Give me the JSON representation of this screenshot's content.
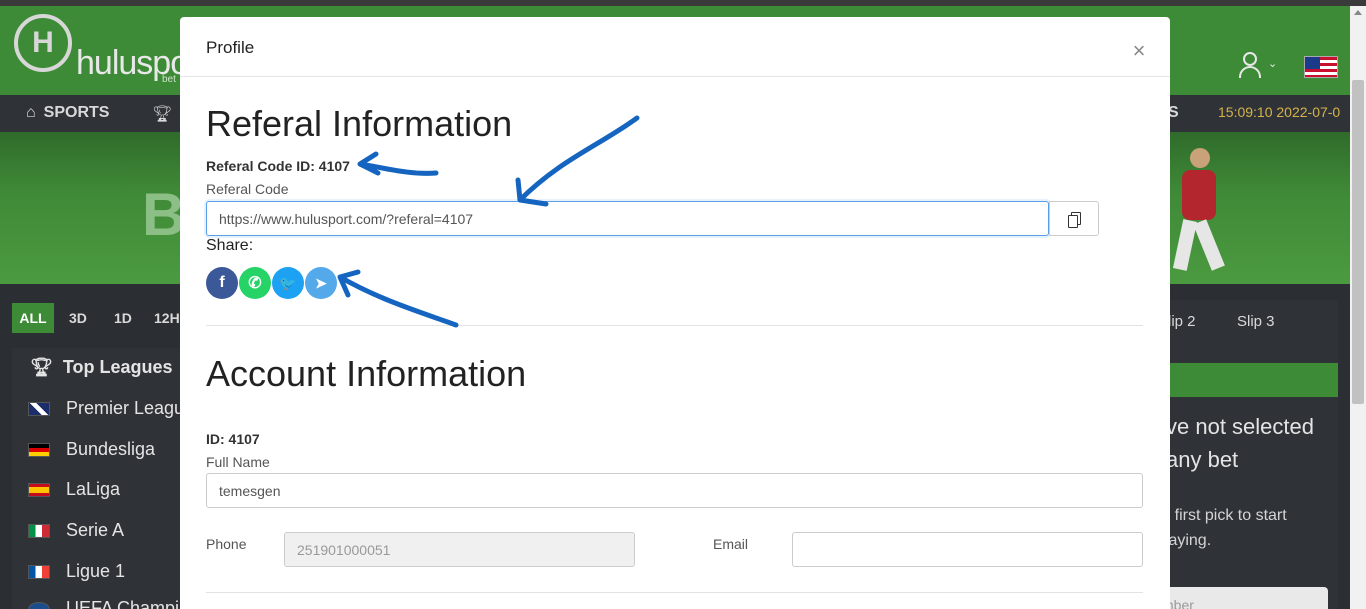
{
  "site": {
    "logo_letter": "H",
    "logo_text": "huluspo",
    "logo_sub": "bet",
    "nav": {
      "sports": "SPORTS",
      "right_fragment": "S",
      "clock": "15:09:10 2022-07-0"
    },
    "banner_letter": "B",
    "filters": [
      "ALL",
      "3D",
      "1D",
      "12H"
    ],
    "top_leagues_title": "Top Leagues",
    "leagues": [
      {
        "name": "Premier Leagu",
        "flag": "england"
      },
      {
        "name": "Bundesliga",
        "flag": "germany"
      },
      {
        "name": "LaLiga",
        "flag": "spain"
      },
      {
        "name": "Serie A",
        "flag": "italy"
      },
      {
        "name": "Ligue 1",
        "flag": "france"
      },
      {
        "name": "UEFA Champi",
        "flag": "europe"
      }
    ],
    "slip_tabs": [
      "lip 2",
      "Slip 3"
    ],
    "slip_message": "ve not selected any bet",
    "slip_sub": "ur first pick to start playing.",
    "slip_input_placeholder": "mber"
  },
  "modal": {
    "title": "Profile",
    "referral": {
      "heading": "Referal Information",
      "code_id": "Referal Code ID: 4107",
      "code_label": "Referal Code",
      "code_value": "https://www.hulusport.com/?referal=4107",
      "share_label": "Share:",
      "share_buttons": [
        {
          "name": "facebook",
          "glyph": "f",
          "color": "#3b5998"
        },
        {
          "name": "whatsapp",
          "glyph": "✆",
          "color": "#25d366"
        },
        {
          "name": "twitter",
          "glyph": "🐦",
          "color": "#1da1f2"
        },
        {
          "name": "telegram",
          "glyph": "➤",
          "color": "#54a9eb"
        }
      ]
    },
    "account": {
      "heading": "Account Information",
      "id": "ID: 4107",
      "full_name_label": "Full Name",
      "full_name_value": "temesgen",
      "phone_label": "Phone",
      "phone_value": "251901000051",
      "email_label": "Email",
      "email_value": ""
    }
  },
  "colors": {
    "brand_green": "#3d8b37",
    "annotation_blue": "#1565c0",
    "focus_blue": "#5a9ee8"
  }
}
